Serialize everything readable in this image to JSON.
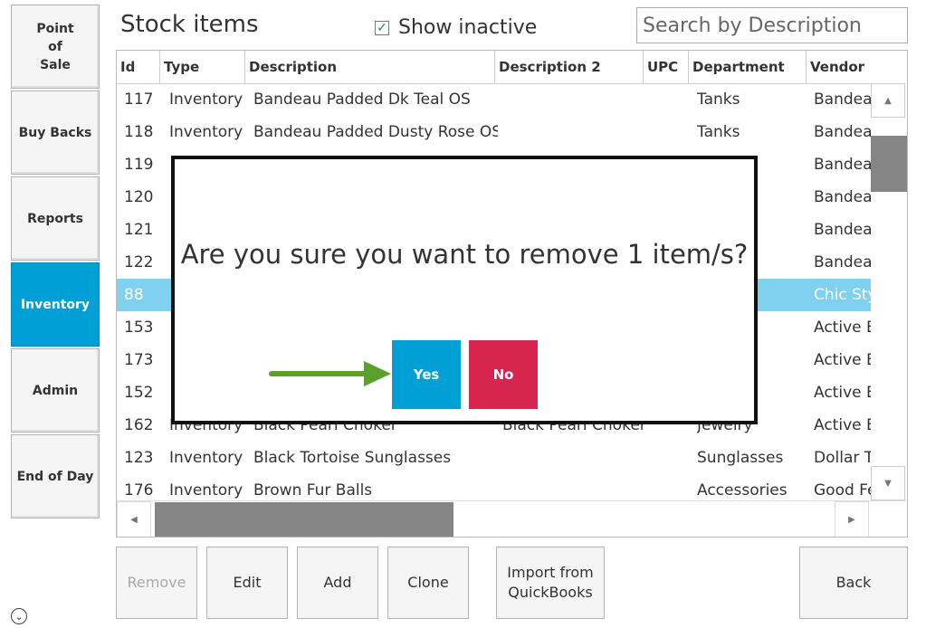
{
  "sidebar": {
    "items": [
      {
        "label": "Point\nof\nSale"
      },
      {
        "label": "Buy Backs"
      },
      {
        "label": "Reports"
      },
      {
        "label": "Inventory"
      },
      {
        "label": "Admin"
      },
      {
        "label": "End of Day"
      }
    ],
    "active": "Inventory"
  },
  "header": {
    "title": "Stock items",
    "show_inactive_label": "Show inactive",
    "show_inactive_checked": true,
    "search_placeholder": "Search by Description"
  },
  "table": {
    "columns": [
      "Id",
      "Type",
      "Description",
      "Description 2",
      "UPC",
      "Department",
      "Vendor"
    ],
    "rows": [
      {
        "id": "117",
        "type": "Inventory",
        "description": "Bandeau Padded Dk Teal OS",
        "description2": "",
        "upc": "",
        "department": "Tanks",
        "vendor": "Bandeau"
      },
      {
        "id": "118",
        "type": "Inventory",
        "description": "Bandeau Padded Dusty Rose OS",
        "description2": "",
        "upc": "",
        "department": "Tanks",
        "vendor": "Bandeau"
      },
      {
        "id": "119",
        "type": "",
        "description": "",
        "description2": "",
        "upc": "",
        "department": "",
        "vendor": "Bandeau"
      },
      {
        "id": "120",
        "type": "",
        "description": "",
        "description2": "",
        "upc": "",
        "department": "",
        "vendor": "Bandeau"
      },
      {
        "id": "121",
        "type": "",
        "description": "",
        "description2": "",
        "upc": "",
        "department": "",
        "vendor": "Bandeau"
      },
      {
        "id": "122",
        "type": "",
        "description": "",
        "description2": "",
        "upc": "",
        "department": "",
        "vendor": "Bandeau"
      },
      {
        "id": "88",
        "type": "",
        "description": "",
        "description2": "",
        "upc": "",
        "department": "",
        "vendor": "Chic Sty",
        "selected": true
      },
      {
        "id": "153",
        "type": "",
        "description": "",
        "description2": "",
        "upc": "",
        "department": "",
        "vendor": "Active B"
      },
      {
        "id": "173",
        "type": "",
        "description": "",
        "description2": "",
        "upc": "",
        "department": "",
        "vendor": "Active B"
      },
      {
        "id": "152",
        "type": "",
        "description": "",
        "description2": "",
        "upc": "",
        "department": "",
        "vendor": "Active B"
      },
      {
        "id": "162",
        "type": "Inventory",
        "description": "Black Pearl Choker",
        "description2": "Black Pearl Choker",
        "upc": "",
        "department": "Jewelry",
        "vendor": "Active B"
      },
      {
        "id": "123",
        "type": "Inventory",
        "description": "Black Tortoise Sunglasses",
        "description2": "",
        "upc": "",
        "department": "Sunglasses",
        "vendor": "Dollar T"
      },
      {
        "id": "176",
        "type": "Inventory",
        "description": "Brown Fur Balls",
        "description2": "",
        "upc": "",
        "department": "Accessories",
        "vendor": "Good Fe"
      }
    ]
  },
  "toolbar": {
    "remove": "Remove",
    "edit": "Edit",
    "add": "Add",
    "clone": "Clone",
    "import": "Import from\nQuickBooks",
    "back": "Back"
  },
  "dialog": {
    "message": "Are you sure you want to remove 1 item/s?",
    "yes": "Yes",
    "no": "No"
  },
  "colors": {
    "active_nav": "#00a0d6",
    "selected_row": "#80d0f0",
    "yes_button": "#00a0d6",
    "no_button": "#d6264f",
    "arrow": "#5aa02c"
  }
}
